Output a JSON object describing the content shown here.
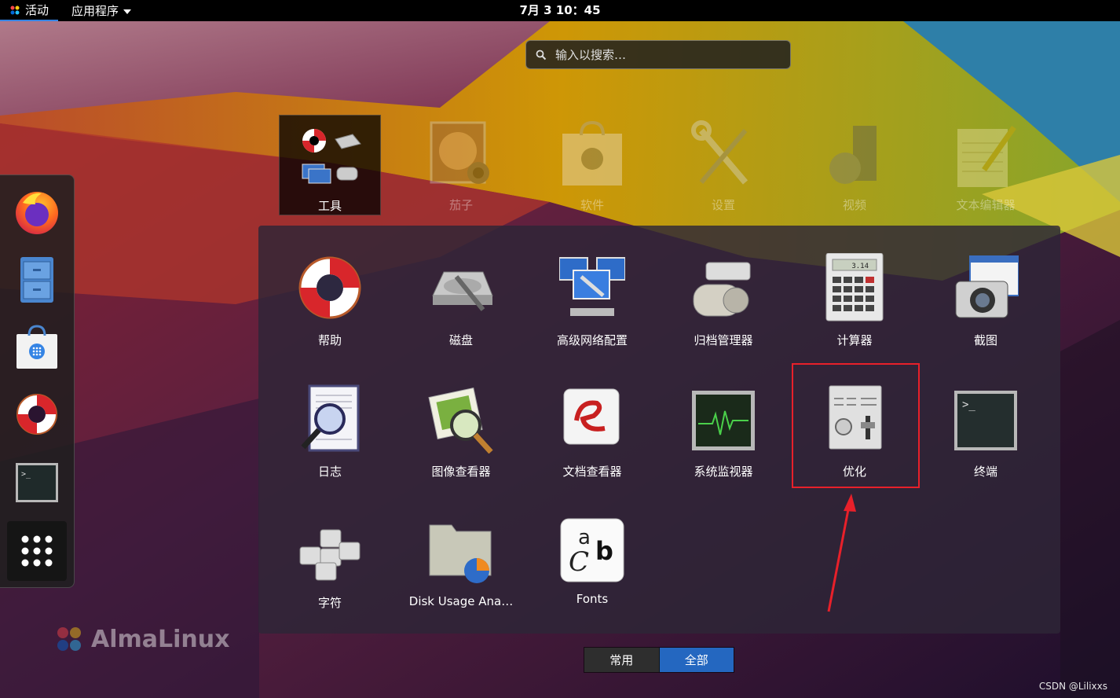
{
  "topbar": {
    "activities": "活动",
    "apps_menu": "应用程序",
    "clock": "7月 3  10：45"
  },
  "search": {
    "placeholder": "输入以搜索…"
  },
  "dash": {
    "items": [
      "firefox",
      "files",
      "software",
      "help",
      "terminal",
      "show-apps"
    ]
  },
  "folders": [
    {
      "label": "工具",
      "icon": "utilities-folder-icon",
      "open": true
    },
    {
      "label": "茄子",
      "icon": "cheese-icon"
    },
    {
      "label": "软件",
      "icon": "software-icon"
    },
    {
      "label": "设置",
      "icon": "settings-icon"
    },
    {
      "label": "视频",
      "icon": "videos-icon"
    },
    {
      "label": "文本编辑器",
      "icon": "text-editor-icon"
    }
  ],
  "folder_apps": [
    {
      "label": "帮助",
      "icon": "help-icon"
    },
    {
      "label": "磁盘",
      "icon": "disks-icon"
    },
    {
      "label": "高级网络配置",
      "icon": "network-config-icon"
    },
    {
      "label": "归档管理器",
      "icon": "archive-manager-icon"
    },
    {
      "label": "计算器",
      "icon": "calculator-icon"
    },
    {
      "label": "截图",
      "icon": "screenshot-icon"
    },
    {
      "label": "日志",
      "icon": "logs-icon"
    },
    {
      "label": "图像查看器",
      "icon": "image-viewer-icon"
    },
    {
      "label": "文档查看器",
      "icon": "document-viewer-icon"
    },
    {
      "label": "系统监视器",
      "icon": "system-monitor-icon"
    },
    {
      "label": "优化",
      "icon": "tweaks-icon"
    },
    {
      "label": "终端",
      "icon": "terminal-icon"
    },
    {
      "label": "字符",
      "icon": "characters-icon"
    },
    {
      "label": "Disk Usage Ana…",
      "icon": "disk-usage-analyzer-icon"
    },
    {
      "label": "Fonts",
      "icon": "fonts-icon"
    }
  ],
  "calculator_display": "3.14",
  "terminal_prompt": ">_",
  "fonts_glyphs": {
    "a": "a",
    "c": "C",
    "b": "b"
  },
  "switcher": {
    "frequent": "常用",
    "all": "全部"
  },
  "brand": "AlmaLinux",
  "watermark": "CSDN @Lilixxs",
  "colors": {
    "highlight": "#e8202a",
    "accent": "#2467c0",
    "arrow": "#e8202a"
  }
}
